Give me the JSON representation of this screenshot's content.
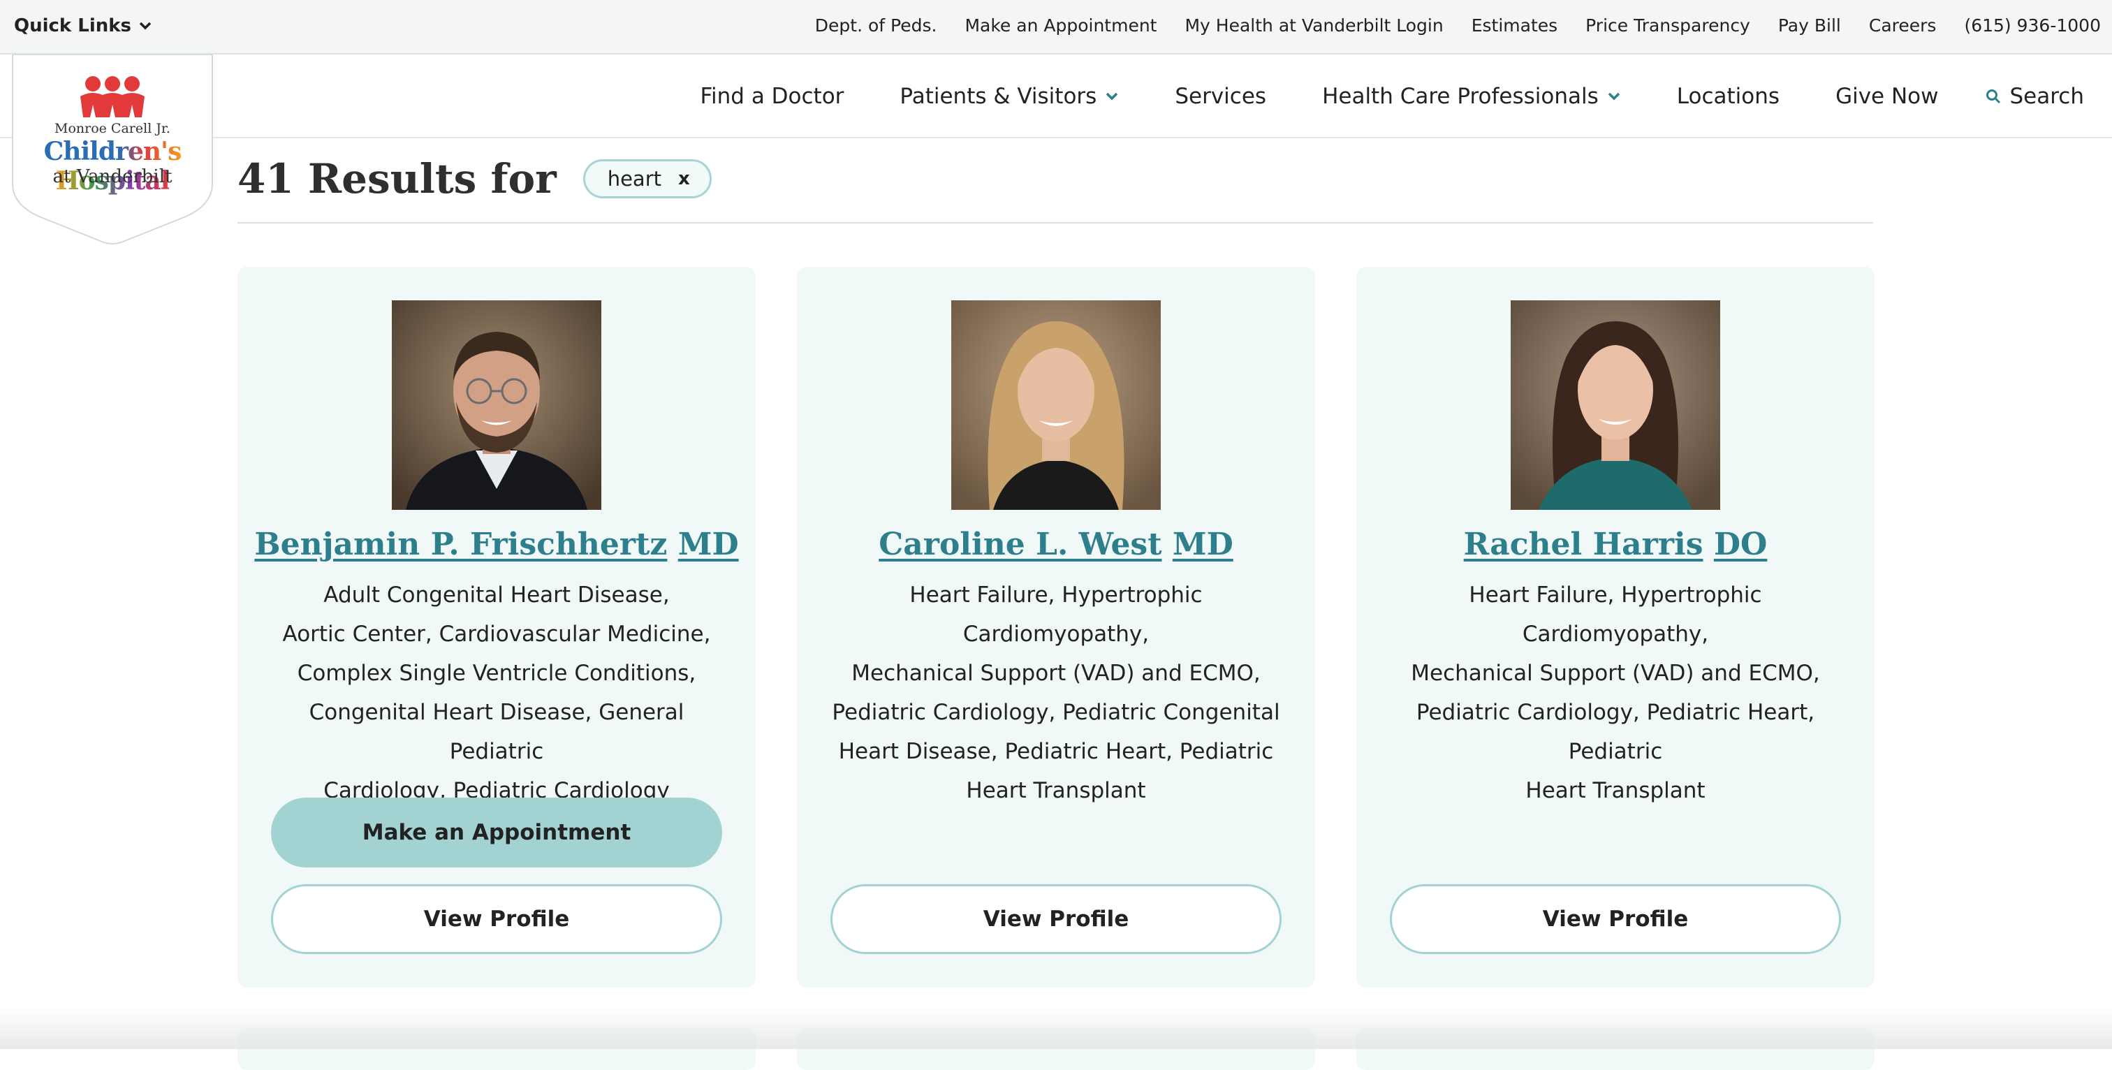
{
  "utility_bar": {
    "quick_links": "Quick Links",
    "links": [
      "Dept. of Peds.",
      "Make an Appointment",
      "My Health at Vanderbilt Login",
      "Estimates",
      "Price Transparency",
      "Pay Bill",
      "Careers",
      "(615) 936-1000"
    ]
  },
  "logo": {
    "line1": "Monroe Carell Jr.",
    "line2": "Children's Hospital",
    "line3": "at Vanderbilt"
  },
  "main_nav": {
    "find_doctor": "Find a Doctor",
    "patients_visitors": "Patients & Visitors",
    "services": "Services",
    "health_care_professionals": "Health Care Professionals",
    "locations": "Locations",
    "give_now": "Give Now",
    "search": "Search"
  },
  "results": {
    "title": "41 Results for",
    "filter_chip": "heart",
    "chip_close": "x"
  },
  "cards": [
    {
      "first": "Benjamin P. Frischhertz",
      "credential": "MD",
      "specialties": [
        "Adult Congenital Heart Disease,",
        "Aortic Center, Cardiovascular Medicine,",
        "Complex Single Ventricle Conditions,",
        "Congenital Heart Disease, General Pediatric",
        "Cardiology, Pediatric Cardiology"
      ],
      "appointment_label": "Make an Appointment",
      "profile_label": "View Profile"
    },
    {
      "first": "Caroline L. West",
      "credential": "MD",
      "specialties": [
        "Heart Failure, Hypertrophic Cardiomyopathy,",
        "Mechanical Support (VAD) and ECMO,",
        "Pediatric Cardiology, Pediatric Congenital",
        "Heart Disease, Pediatric Heart, Pediatric",
        "Heart Transplant"
      ],
      "profile_label": "View Profile"
    },
    {
      "first": "Rachel Harris",
      "credential": "DO",
      "specialties": [
        "Heart Failure, Hypertrophic Cardiomyopathy,",
        "Mechanical Support (VAD) and ECMO,",
        "Pediatric Cardiology, Pediatric Heart, Pediatric",
        "Heart Transplant"
      ],
      "profile_label": "View Profile"
    }
  ],
  "colors": {
    "accent": "#2e7f8c",
    "button_fill": "#a3d2d3",
    "card_bg": "#f0f8f8"
  }
}
